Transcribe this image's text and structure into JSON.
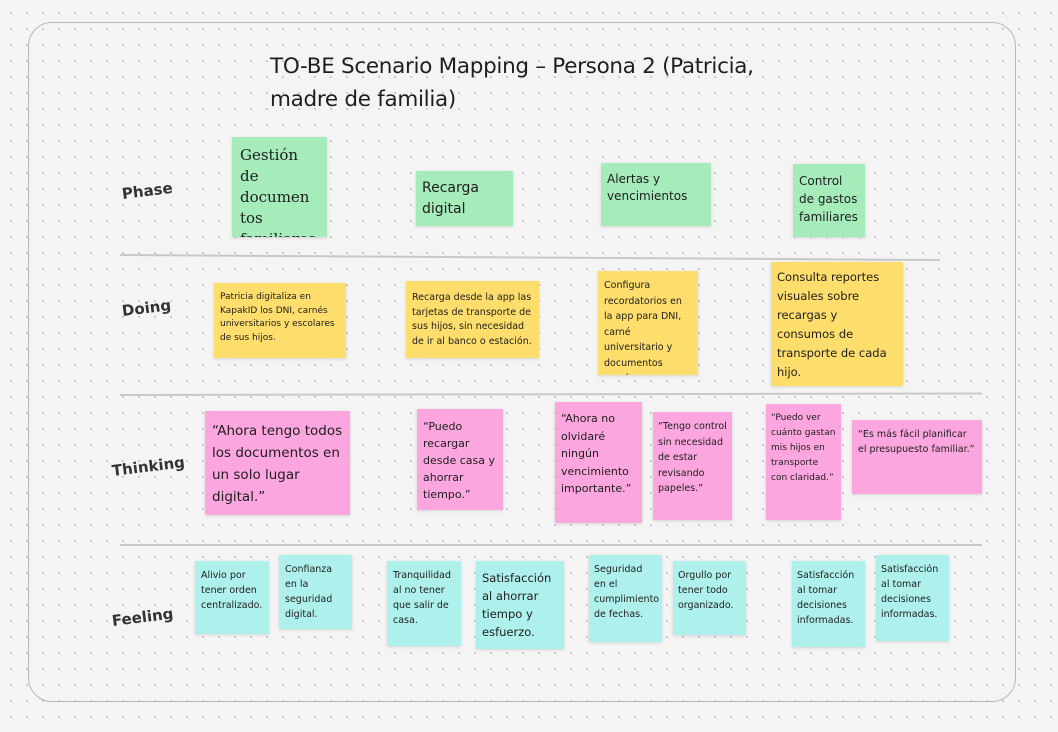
{
  "title": "TO-BE Scenario Mapping – Persona 2 (Patricia, madre de familia)",
  "rows": {
    "phase": "Phase",
    "doing": "Doing",
    "thinking": "Thinking",
    "feeling": "Feeling"
  },
  "phase": [
    "Gestión de documen tos familiares",
    "Recarga digital",
    "Alertas y vencimientos",
    "Control de gastos familiares"
  ],
  "doing": [
    "Patricia digitaliza en KapakID los DNI, carnés universitarios y escolares de sus hijos.",
    "Recarga desde la app las tarjetas de transporte de sus hijos, sin necesidad de ir al banco o estación.",
    "Configura recordatorios en la app para DNI, carné universitario y documentos escolares.",
    "Consulta reportes visuales sobre recargas y consumos de transporte de cada hijo."
  ],
  "thinking": [
    "“Ahora tengo todos los documentos en un solo lugar digital.”",
    "“Puedo recargar desde casa y ahorrar tiempo.”",
    "“Ahora no olvidaré ningún vencimiento importante.”",
    "“Tengo control sin necesidad de estar revisando papeles.”",
    "“Puedo ver cuánto gastan mis hijos en transporte con claridad.”",
    "“Es más fácil planificar el presupuesto familiar.”"
  ],
  "feeling": [
    "Alivio por tener orden centralizado.",
    "Confianza en la seguridad digital.",
    "Tranquilidad al no tener que salir de casa.",
    "Satisfacción al ahorrar tiempo y esfuerzo.",
    "Seguridad en el cumplimiento de fechas.",
    "Orgullo por tener todo organizado.",
    "Satisfacción al tomar decisiones informadas.",
    "Satisfacción al tomar decisiones informadas."
  ],
  "colors": {
    "phase": "#a6ecbb",
    "doing": "#fddd6c",
    "thinking": "#fca6df",
    "feeling": "#aef0ec"
  }
}
